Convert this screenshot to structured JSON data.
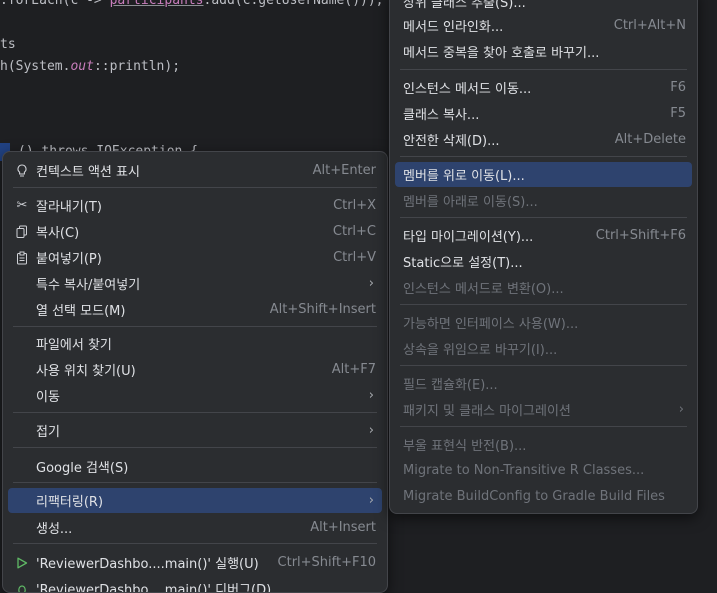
{
  "editor": {
    "line1_pre": ".forEach(c -> ",
    "line1_field": "participants",
    "line1_post": ".add(c.getUserName()));",
    "line2": "ts",
    "line3_pre": "h(System.",
    "line3_field": "out",
    "line3_post": "::println);",
    "line4": "() throws IOException {"
  },
  "context_menu": {
    "items": [
      {
        "label": "컨텍스트 액션 표시",
        "shortcut": "Alt+Enter",
        "icon": "lightbulb-icon"
      },
      {
        "label": "잘라내기(T)",
        "shortcut": "Ctrl+X",
        "icon": "scissors-icon"
      },
      {
        "label": "복사(C)",
        "shortcut": "Ctrl+C",
        "icon": "copy-icon"
      },
      {
        "label": "붙여넣기(P)",
        "shortcut": "Ctrl+V",
        "icon": "paste-icon"
      },
      {
        "label": "특수 복사/붙여넣기",
        "shortcut": ""
      },
      {
        "label": "열 선택 모드(M)",
        "shortcut": "Alt+Shift+Insert"
      },
      {
        "label": "파일에서 찾기",
        "shortcut": ""
      },
      {
        "label": "사용 위치 찾기(U)",
        "shortcut": "Alt+F7"
      },
      {
        "label": "이동",
        "shortcut": ""
      },
      {
        "label": "접기",
        "shortcut": ""
      },
      {
        "label": "Google 검색(S)",
        "shortcut": ""
      },
      {
        "label": "리팩터링(R)",
        "shortcut": ""
      },
      {
        "label": "생성...",
        "shortcut": "Alt+Insert"
      },
      {
        "label": "'ReviewerDashbo....main()' 실행(U)",
        "shortcut": "Ctrl+Shift+F10",
        "icon": "run-icon"
      },
      {
        "label": "'ReviewerDashbo....main()' 디버그(D)",
        "shortcut": "",
        "icon": "debug-icon"
      }
    ]
  },
  "refactor_menu": {
    "items": [
      {
        "label": "상위 클래스 추출(S)...",
        "shortcut": ""
      },
      {
        "label": "메서드 인라인화...",
        "shortcut": "Ctrl+Alt+N"
      },
      {
        "label": "메서드 중복을 찾아 호출로 바꾸기...",
        "shortcut": ""
      },
      {
        "label": "인스턴스 메서드 이동...",
        "shortcut": "F6"
      },
      {
        "label": "클래스 복사...",
        "shortcut": "F5"
      },
      {
        "label": "안전한 삭제(D)...",
        "shortcut": "Alt+Delete"
      },
      {
        "label": "멤버를 위로 이동(L)...",
        "shortcut": ""
      },
      {
        "label": "멤버를 아래로 이동(S)...",
        "shortcut": ""
      },
      {
        "label": "타입 마이그레이션(Y)...",
        "shortcut": "Ctrl+Shift+F6"
      },
      {
        "label": "Static으로 설정(T)...",
        "shortcut": ""
      },
      {
        "label": "인스턴스 메서드로 변환(O)...",
        "shortcut": ""
      },
      {
        "label": "가능하면 인터페이스 사용(W)...",
        "shortcut": ""
      },
      {
        "label": "상속을 위임으로 바꾸기(I)...",
        "shortcut": ""
      },
      {
        "label": "필드 캡슐화(E)...",
        "shortcut": ""
      },
      {
        "label": "패키지 및 클래스 마이그레이션",
        "shortcut": ""
      },
      {
        "label": "부울 표현식 반전(B)...",
        "shortcut": ""
      },
      {
        "label": "Migrate to Non-Transitive R Classes...",
        "shortcut": ""
      },
      {
        "label": "Migrate BuildConfig to Gradle Build Files",
        "shortcut": ""
      }
    ]
  }
}
